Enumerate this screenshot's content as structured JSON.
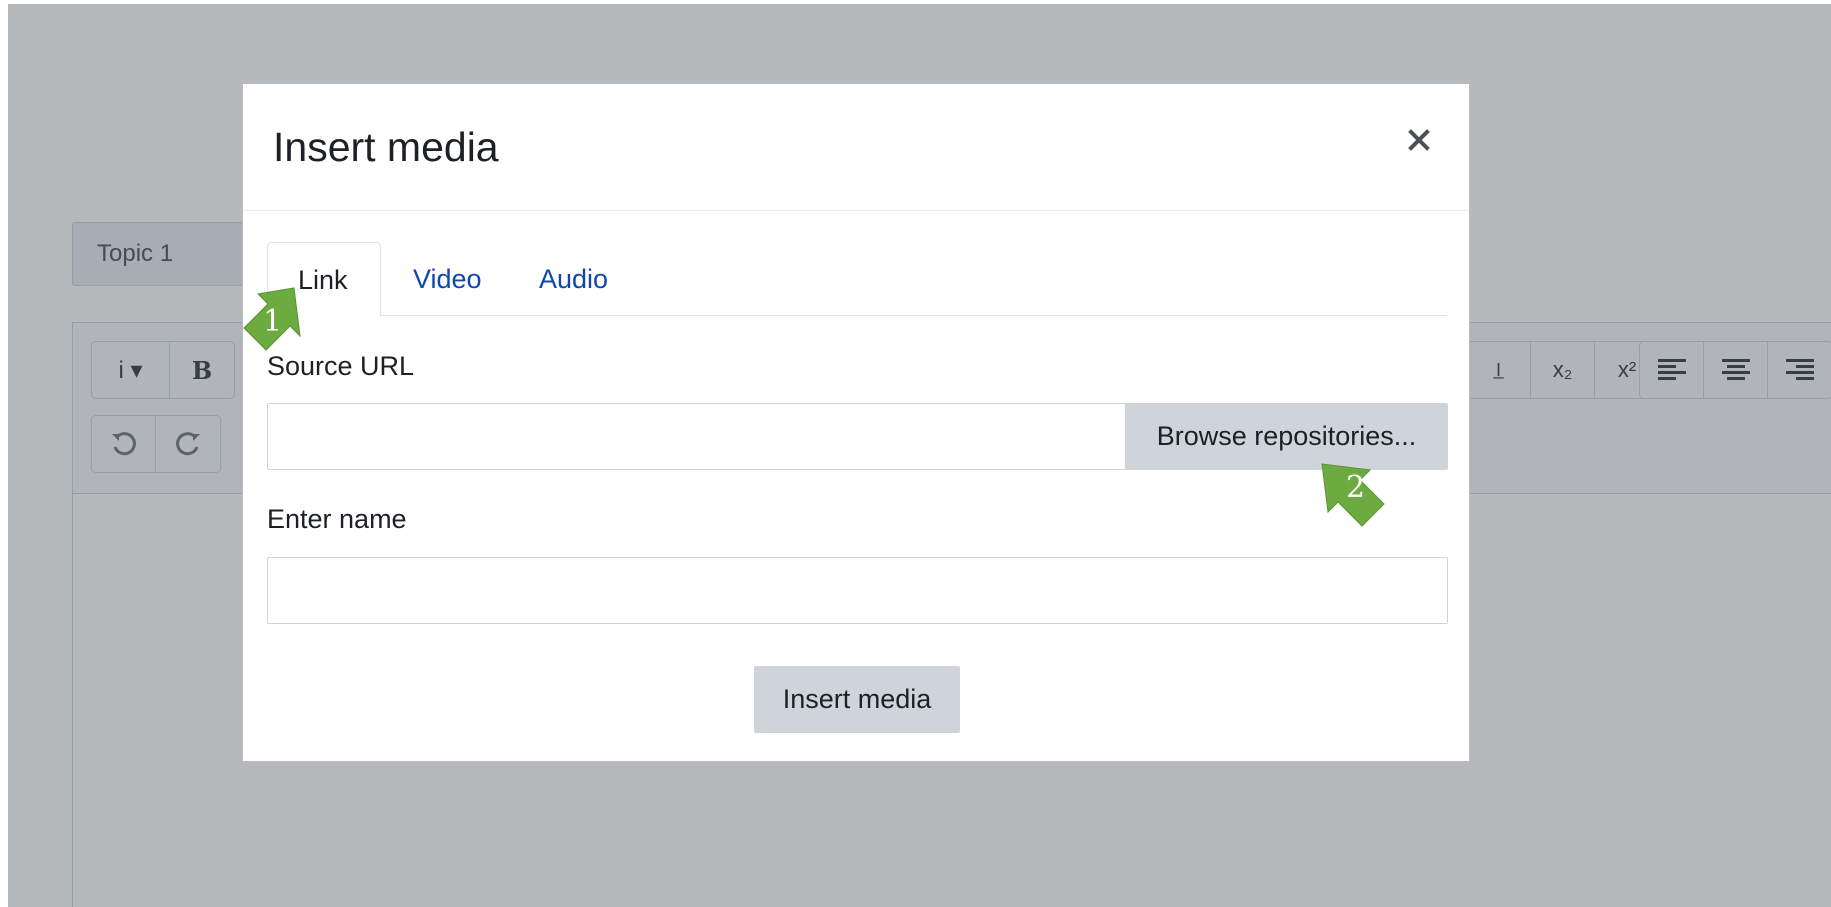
{
  "background": {
    "topic_field": "Topic 1",
    "toolbar_row1": {
      "group1": [
        "i ▾",
        "B"
      ],
      "group2": [
        "I̲",
        "x₂",
        "x²"
      ],
      "group3": [
        "align-left-icon",
        "align-center-icon",
        "align-right-icon"
      ]
    },
    "toolbar_row2": [
      "undo-icon",
      "redo-icon"
    ]
  },
  "modal": {
    "title": "Insert media",
    "close_label": "×",
    "tabs": [
      {
        "label": "Link",
        "active": true
      },
      {
        "label": "Video",
        "active": false
      },
      {
        "label": "Audio",
        "active": false
      }
    ],
    "source_url": {
      "label": "Source URL",
      "value": "",
      "browse_button": "Browse repositories..."
    },
    "name_field": {
      "label": "Enter name",
      "value": ""
    },
    "submit_button": "Insert media"
  },
  "callouts": [
    "1",
    "2"
  ],
  "colors": {
    "link": "#0f47ad",
    "button_bg": "#ced4da",
    "callout_green": "#6cab3f",
    "overlay": "rgba(60,70,80,0.38)"
  }
}
